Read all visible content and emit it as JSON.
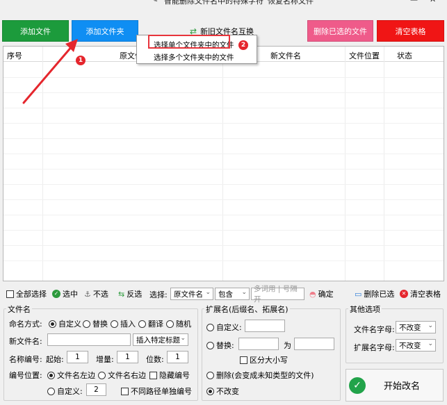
{
  "topbar": {
    "left_text": "智能删除文件名中的特殊字符",
    "right_text": "恢复名称文件"
  },
  "buttons": {
    "add_file": "添加文件",
    "add_folder": "添加文件夹",
    "swap_names": "新旧文件名互换",
    "delete_selected": "删除已选的文件",
    "clear_table": "清空表格"
  },
  "menu": {
    "items": [
      "选择单个文件夹中的文件",
      "选择多个文件夹中的文件"
    ],
    "badge1": "1",
    "badge2": "2"
  },
  "table": {
    "columns": [
      "序号",
      "原文件名",
      "新文件名",
      "文件位置",
      "状态"
    ]
  },
  "toolbar": {
    "select_all": "全部选择",
    "select": "选中",
    "unselect": "不选",
    "invert": "反选",
    "choose_label": "选择:",
    "field_option": "原文件名",
    "match_option": "包含",
    "filter_placeholder": "多词用 | 号隔开",
    "confirm": "确定",
    "delete_selected": "删除已选",
    "clear_table": "清空表格"
  },
  "filename": {
    "title": "文件名",
    "mode_label": "命名方式:",
    "modes": [
      "自定义",
      "替换",
      "插入",
      "翻译",
      "随机"
    ],
    "new_name_label": "新文件名:",
    "insert_title": "插入特定标题",
    "number_label": "名称编号:",
    "start_label": "起始:",
    "start_value": "1",
    "step_label": "增量:",
    "step_value": "1",
    "digits_label": "位数:",
    "digits_value": "1",
    "position_label": "编号位置:",
    "pos_left": "文件名左边",
    "pos_right": "文件名右边",
    "hide_number": "隐藏编号",
    "custom_label": "自定义:",
    "custom_value": "2",
    "separate_path": "不同路径单独编号"
  },
  "extension": {
    "title": "扩展名(后缀名、拓展名)",
    "custom": "自定义:",
    "replace": "替换:",
    "to": "为",
    "case_sensitive": "区分大小写",
    "delete": "删除(会变成未知类型的文件)",
    "no_change": "不改变"
  },
  "other": {
    "title": "其他选项",
    "filename_case_label": "文件名字母:",
    "filename_case_value": "不改变",
    "ext_case_label": "扩展名字母:",
    "ext_case_value": "不改变",
    "start_button": "开始改名"
  },
  "colors": {
    "add_file": "#1c9b3c",
    "add_folder": "#0f8ef3",
    "delete_selected": "#ef5b8a",
    "clear_table": "#f01515",
    "annotation": "#e5262d"
  }
}
